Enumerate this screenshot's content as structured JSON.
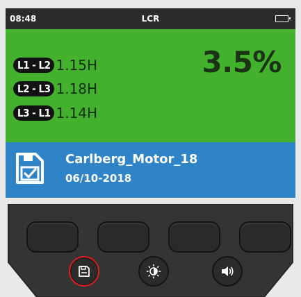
{
  "status_bar": {
    "time": "08:48",
    "title": "LCR",
    "battery_icon": "battery-icon"
  },
  "readings": [
    {
      "phase": "L1 - L2",
      "value": "1.15H"
    },
    {
      "phase": "L2 - L3",
      "value": "1.18H"
    },
    {
      "phase": "L3 - L1",
      "value": "1.14H"
    }
  ],
  "percentage": "3.5%",
  "file": {
    "icon": "save-check-icon",
    "name": "Carlberg_Motor_18",
    "date": "06/10-2018"
  },
  "soft_keys": [
    "soft-key-1",
    "soft-key-2",
    "soft-key-3",
    "soft-key-4"
  ],
  "round_buttons": [
    {
      "icon": "save-icon",
      "highlighted": true
    },
    {
      "icon": "brightness-icon",
      "highlighted": false
    },
    {
      "icon": "volume-icon",
      "highlighted": false
    }
  ],
  "colors": {
    "status_bar": "#2b2b2b",
    "measure_panel": "#43b12e",
    "file_panel": "#2e84c6",
    "device_body": "#333333",
    "highlight_ring": "#e01f1f"
  }
}
